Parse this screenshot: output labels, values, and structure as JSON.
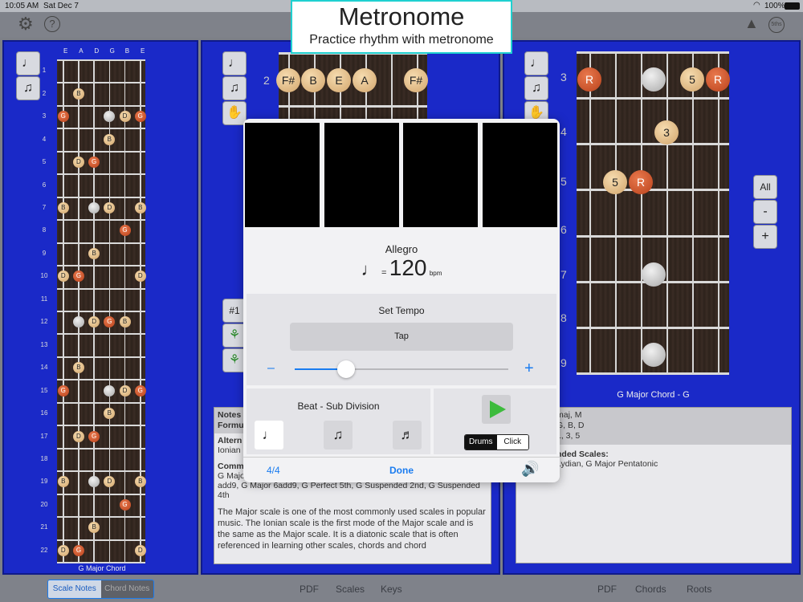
{
  "status": {
    "time": "10:05 AM",
    "date": "Sat Dec 7",
    "battery": "100%"
  },
  "topbar": {
    "help": "?",
    "right_badge": "5ths"
  },
  "left_panel": {
    "strings": [
      "E",
      "A",
      "D",
      "G",
      "B",
      "E"
    ],
    "frets": [
      "1",
      "2",
      "3",
      "4",
      "5",
      "6",
      "7",
      "8",
      "9",
      "10",
      "11",
      "12",
      "13",
      "14",
      "15",
      "16",
      "17",
      "18",
      "19",
      "20",
      "21",
      "22"
    ],
    "caption": "G Major Chord",
    "notes": [
      [
        "B"
      ],
      [
        "G",
        "D",
        "G"
      ],
      [
        "B"
      ],
      [
        "D",
        "G"
      ],
      [
        "B",
        "D",
        "B"
      ],
      [
        "G"
      ],
      [
        "B"
      ],
      [
        "D",
        "G",
        "D"
      ],
      [
        "D",
        "G",
        "B"
      ],
      [
        "B"
      ],
      [
        "G",
        "D",
        "G"
      ],
      [
        "B"
      ],
      [
        "D",
        "G"
      ],
      [
        "B",
        "D",
        "B"
      ],
      [
        "G"
      ],
      [
        "B"
      ],
      [
        "D",
        "G",
        "D"
      ]
    ]
  },
  "mid_panel": {
    "fret_label": "2",
    "notes": [
      "F#",
      "B",
      "E",
      "A",
      "F#"
    ],
    "buttons": [
      "#1"
    ]
  },
  "right_panel": {
    "frets": [
      "3",
      "4",
      "5",
      "6",
      "7",
      "8",
      "9"
    ],
    "caption": "G Major Chord - G",
    "zoom": [
      "All",
      "-",
      "+"
    ],
    "info_lines": [
      "maj, M",
      "G, B, D",
      "1, 3, 5"
    ],
    "info_heading": "nded Scales:",
    "info_scales": "Lydian, G Major Pentatonic",
    "dots": {
      "r1": [
        "R",
        "5",
        "R"
      ],
      "r2": [
        "3"
      ],
      "r3": [
        "5",
        "R"
      ]
    }
  },
  "mid_info": {
    "h1": "Notes",
    "h2": "Formu",
    "alt_h": "Altern",
    "alt_v": "Ionian",
    "comm_h": "Comm",
    "comm_v": "G Major, G Major 7th, G Major 9th, G Major 13th, G Major 6th, G Major add9, G Major 6add9, G Perfect 5th, G Suspended 2nd, G Suspended 4th",
    "desc": "The Major scale is one of the most commonly used scales in popular music. The Ionian scale is the first mode of the Major scale and is the same as the Major scale. It is a diatonic scale that is often referenced in learning other scales, chords and chord"
  },
  "overlay": {
    "title": "Metronome",
    "subtitle": "Practice rhythm with metronome"
  },
  "metronome": {
    "tempo_name": "Allegro",
    "eq": "=",
    "bpm": "120",
    "bpm_unit": "bpm",
    "tempo_fraction": 0.24,
    "set_tempo": "Set Tempo",
    "tap": "Tap",
    "minus": "–",
    "plus": "+",
    "beat_title": "Beat - Sub Division",
    "sound": [
      "Drums",
      "Click"
    ],
    "time_sig": "4/4",
    "done": "Done"
  },
  "bottom": {
    "scale_notes": "Scale Notes",
    "chord_notes": "Chord Notes",
    "left": [
      "PDF",
      "Scales",
      "Keys"
    ],
    "right": [
      "PDF",
      "Chords",
      "Roots"
    ]
  },
  "colors": {
    "panel": "#1a29c8",
    "accent": "#1a7cf0",
    "play": "#3dbb3d"
  }
}
